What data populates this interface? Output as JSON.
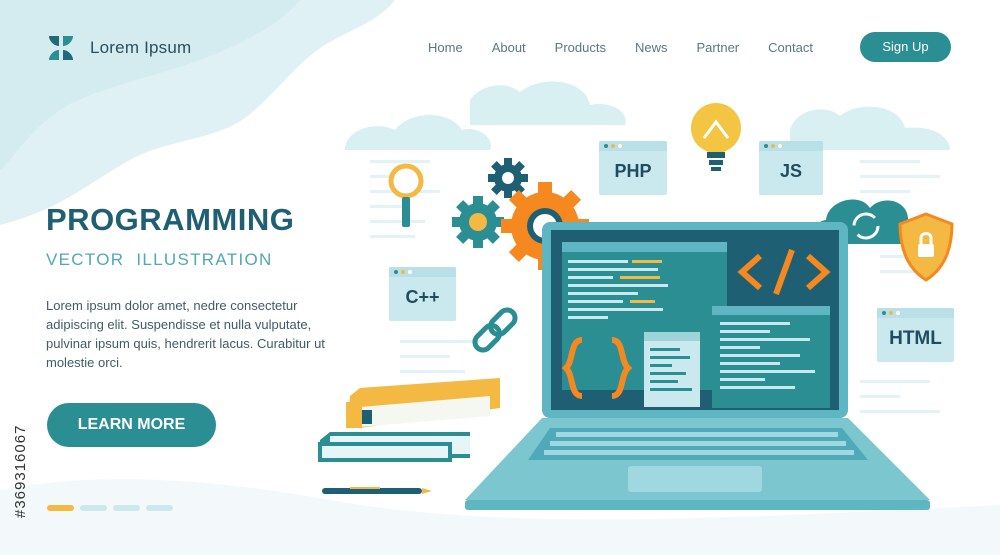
{
  "brand": {
    "name": "Lorem Ipsum",
    "icon": "leaf-logo-icon"
  },
  "nav": {
    "items": [
      "Home",
      "About",
      "Products",
      "News",
      "Partner",
      "Contact"
    ],
    "signup_label": "Sign Up"
  },
  "hero": {
    "title": "PROGRAMMING",
    "subtitle": "VECTOR  ILLUSTRATION",
    "body": "Lorem ipsum dolor  amet, nedre consectetur adipiscing elit. Suspendisse et nulla vulputate, pulvinar ipsum quis, hendrerit lacus. Curabitur ut molestie orci.",
    "cta_label": "LEARN MORE"
  },
  "slider": {
    "total": 4,
    "active_index": 0
  },
  "illustration": {
    "tags": {
      "php": "PHP",
      "js": "JS",
      "cpp": "C++",
      "html": "HTML"
    },
    "icons": [
      "magnifier-icon",
      "gears-icon",
      "lightbulb-icon",
      "cloud-sync-icon",
      "shield-lock-icon",
      "chain-link-icon",
      "code-tag-icon",
      "curly-braces-icon",
      "laptop-icon",
      "books-icon",
      "pen-icon"
    ]
  },
  "watermark": {
    "text": "#369316067"
  },
  "colors": {
    "primary": "#2a8e92",
    "accent": "#f4b942",
    "orange": "#f5891f",
    "dark": "#1f5f74",
    "light": "#cde8ec"
  }
}
